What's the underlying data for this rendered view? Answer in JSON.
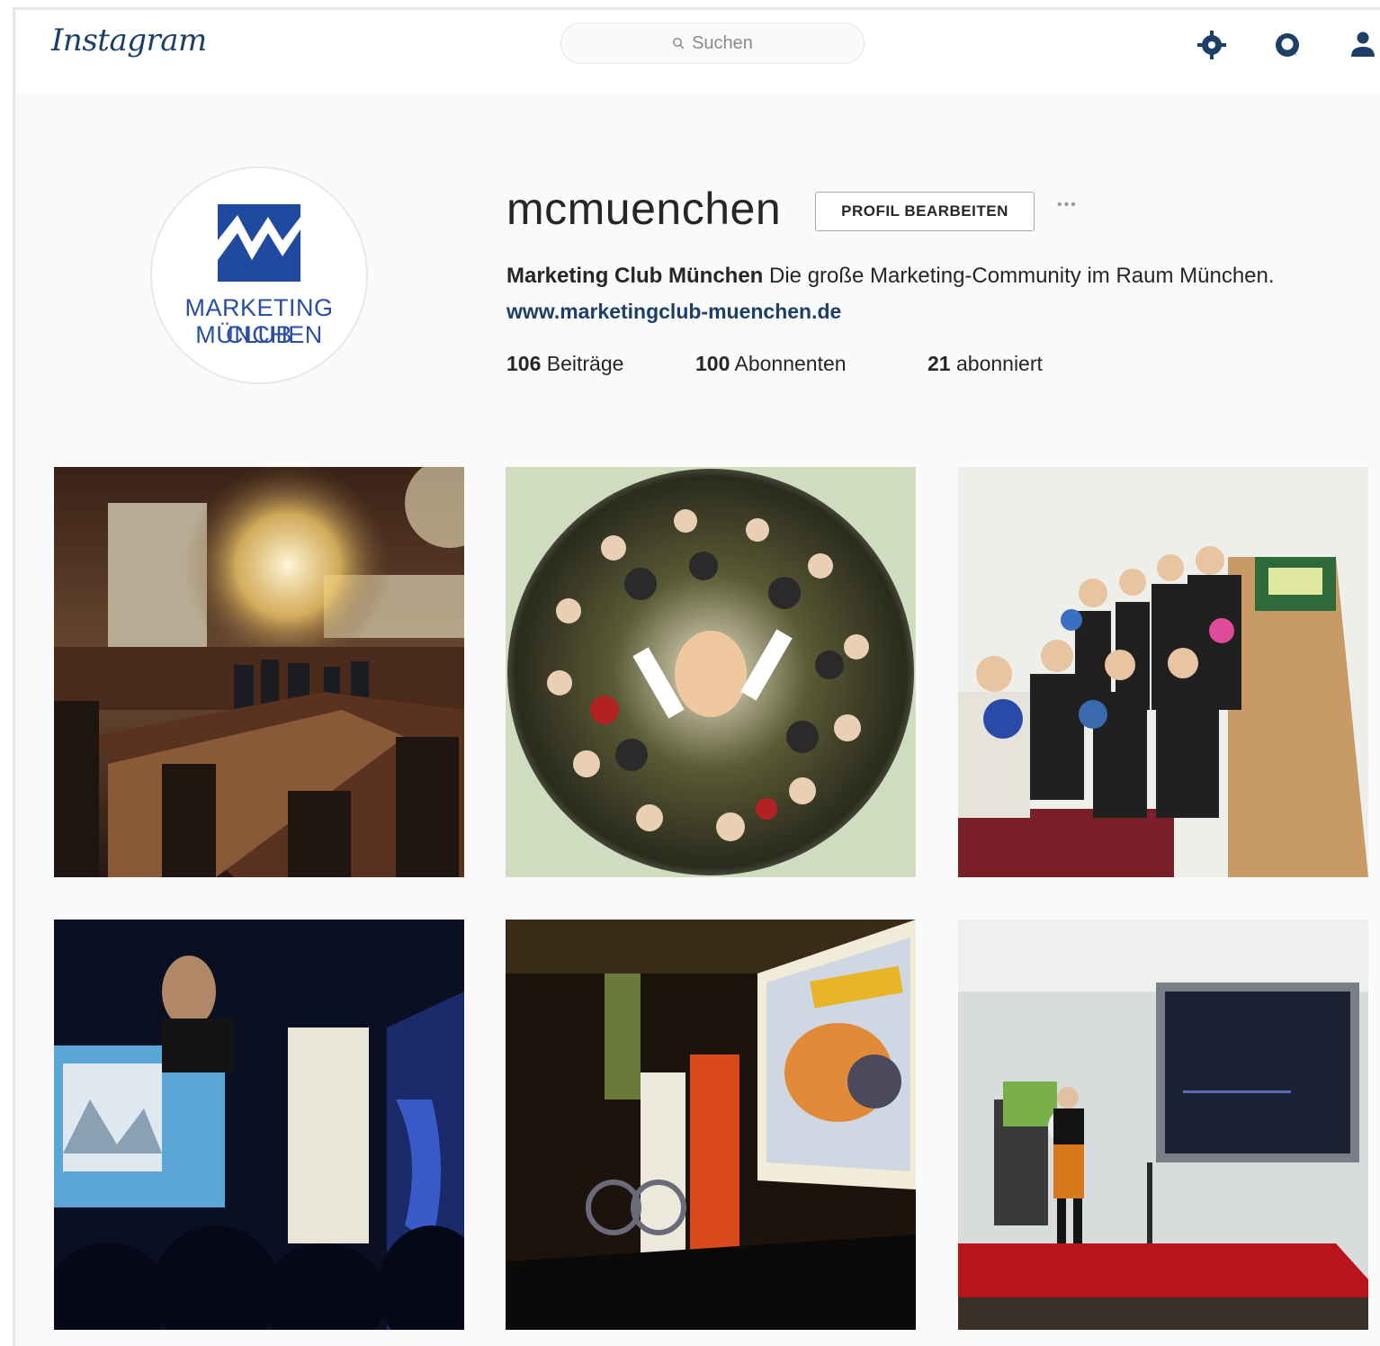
{
  "header": {
    "logo_text": "Instagram",
    "search_placeholder": "Suchen",
    "icons": [
      "explore-icon",
      "heart-icon",
      "profile-icon"
    ]
  },
  "profile": {
    "username": "mcmuenchen",
    "edit_label": "PROFIL BEARBEITEN",
    "more_label": "•••",
    "avatar_line1": "MARKETING CLUB",
    "avatar_line2": "MÜNCHEN",
    "bio_name": "Marketing Club München",
    "bio_text": " Die große Marketing-Community im Raum München.",
    "website": "www.marketingclub-muenchen.de",
    "stats": {
      "posts_count": "106",
      "posts_label": "Beiträge",
      "followers_count": "100",
      "followers_label": "Abonnenten",
      "following_count": "21",
      "following_label": "abonniert"
    }
  },
  "posts": [
    "post-town-hall",
    "post-group-circle",
    "post-bowling",
    "post-stage-speaker",
    "post-ready-presentation",
    "post-red-stage"
  ],
  "colors": {
    "brand_blue": "#1f4aa0",
    "link_blue": "#1b3f66",
    "text": "#262626",
    "background": "#fafafa"
  }
}
